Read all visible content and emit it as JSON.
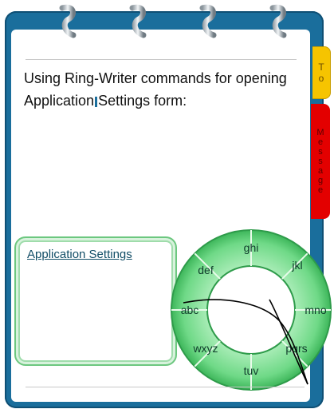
{
  "instruction": "Using Ring-Writer commands for opening Application Settings form:",
  "instruction_parts": [
    "Using Ring-Writer commands for opening Application",
    "Settings form:"
  ],
  "tabs": {
    "to": "To",
    "message": "Message"
  },
  "app_settings_link": "Application Settings",
  "wheel": {
    "keys": [
      "ghi",
      "jkl",
      "mno",
      "pqrs",
      "tuv",
      "wxyz",
      "abc",
      "def"
    ]
  },
  "colors": {
    "frame_blue": "#1a6e9c",
    "tab_yellow": "#f6c400",
    "tab_red": "#e30000",
    "wheel_green": "#5fcf78"
  }
}
